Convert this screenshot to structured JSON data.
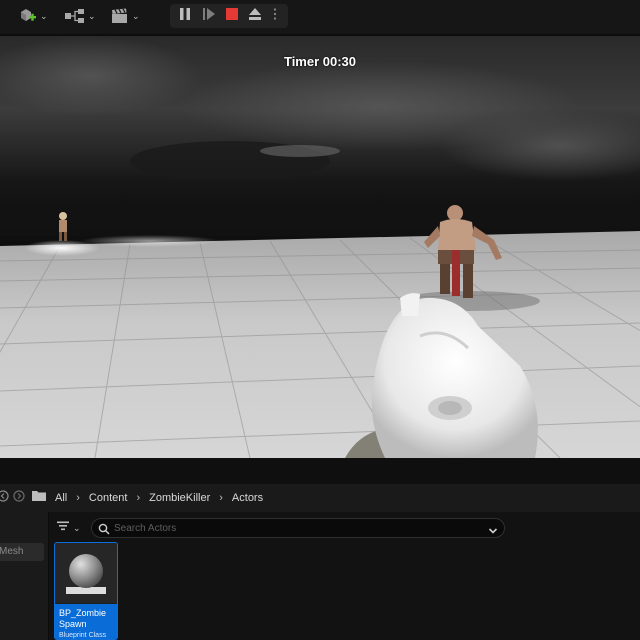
{
  "toolbar": {
    "add_icon": "add-actor-icon",
    "select_mode_icon": "blueprint-icon",
    "cinematics_icon": "clapperboard-icon",
    "play_controls": [
      "pause-icon",
      "frame-skip-icon",
      "stop-icon",
      "eject-icon",
      "more-options-icon"
    ],
    "stop_color": "#e53935"
  },
  "viewport": {
    "timer_text": "Timer 00:30"
  },
  "content_browser": {
    "breadcrumb": [
      "All",
      "Content",
      "ZombieKiller",
      "Actors"
    ],
    "left_pane_item": "Mesh",
    "search": {
      "placeholder": "Search Actors",
      "value": ""
    },
    "assets": [
      {
        "name": "BP_Zombie Spawn",
        "type": "Blueprint Class"
      }
    ],
    "accent_color": "#0a6cd6"
  }
}
